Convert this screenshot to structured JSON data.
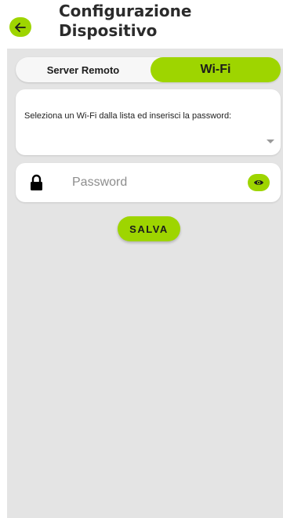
{
  "header": {
    "title_line1": "Configurazione",
    "title_line2": "Dispositivo",
    "back_icon": "arrow-left-icon"
  },
  "tabs": [
    {
      "label": "Server Remoto",
      "selected": false
    },
    {
      "label": "Wi-Fi",
      "selected": true
    }
  ],
  "wifi_select": {
    "label": "Seleziona un Wi-Fi dalla lista ed inserisci la password:",
    "icon": "dropdown-arrow-icon"
  },
  "password": {
    "placeholder": "Password",
    "value": "",
    "lock_icon": "lock-icon",
    "toggle_icon": "eye-icon"
  },
  "save_label": "SALVA",
  "colors": {
    "accent": "#9ed500",
    "background": "#e4e4e4",
    "card": "#ffffff"
  }
}
